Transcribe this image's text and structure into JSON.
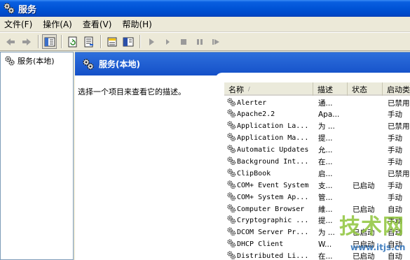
{
  "window": {
    "title": "服务"
  },
  "menu": {
    "items": [
      "文件(F)",
      "操作(A)",
      "查看(V)",
      "帮助(H)"
    ]
  },
  "tree": {
    "root_label": "服务(本地)"
  },
  "panel": {
    "header": "服务(本地)",
    "description": "选择一个项目来查看它的描述。"
  },
  "columns": {
    "name": "名称",
    "desc": "描述",
    "status": "状态",
    "startup": "启动类"
  },
  "services": [
    {
      "name": "Alerter",
      "desc": "通...",
      "status": "",
      "startup": "已禁用"
    },
    {
      "name": "Apache2.2",
      "desc": "Apa...",
      "status": "",
      "startup": "手动"
    },
    {
      "name": "Application La...",
      "desc": "为 ...",
      "status": "",
      "startup": "已禁用"
    },
    {
      "name": "Application Ma...",
      "desc": "提...",
      "status": "",
      "startup": "手动"
    },
    {
      "name": "Automatic Updates",
      "desc": "允...",
      "status": "",
      "startup": "手动"
    },
    {
      "name": "Background Int...",
      "desc": "在...",
      "status": "",
      "startup": "手动"
    },
    {
      "name": "ClipBook",
      "desc": "启...",
      "status": "",
      "startup": "已禁用"
    },
    {
      "name": "COM+ Event System",
      "desc": "支...",
      "status": "已启动",
      "startup": "手动"
    },
    {
      "name": "COM+ System Ap...",
      "desc": "管...",
      "status": "",
      "startup": "手动"
    },
    {
      "name": "Computer Browser",
      "desc": "維...",
      "status": "已启动",
      "startup": "自动"
    },
    {
      "name": "Cryptographic ...",
      "desc": "提...",
      "status": "",
      "startup": "手动"
    },
    {
      "name": "DCOM Server Pr...",
      "desc": "为 ...",
      "status": "已启动",
      "startup": "自动"
    },
    {
      "name": "DHCP Client",
      "desc": "W...",
      "status": "已启动",
      "startup": "自动"
    },
    {
      "name": "Distributed Li...",
      "desc": "在...",
      "status": "已启动",
      "startup": "自动"
    }
  ],
  "watermark": {
    "line1": "技术网",
    "line2": "www.itjs.cn"
  },
  "colors": {
    "title_blue": "#0053d6",
    "header_blue": "#1f5fd2",
    "watermark_green": "#8fc53c"
  }
}
